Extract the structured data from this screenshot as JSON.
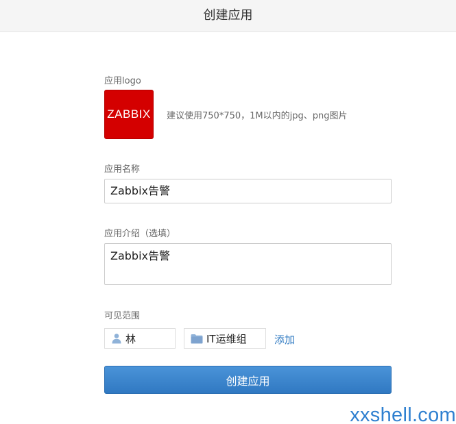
{
  "header": {
    "title": "创建应用"
  },
  "form": {
    "logo_label": "应用logo",
    "logo_text": "ZABBIX",
    "logo_hint": "建议使用750*750，1M以内的jpg、png图片",
    "name_label": "应用名称",
    "name_value": "Zabbix告警",
    "desc_label": "应用介绍（选填）",
    "desc_value": "Zabbix告警",
    "visibility_label": "可见范围",
    "visibility_items": [
      {
        "type": "user",
        "icon": "user-icon",
        "label": "林"
      },
      {
        "type": "department",
        "icon": "folder-icon",
        "label": "IT运维组"
      }
    ],
    "add_label": "添加",
    "submit_label": "创建应用"
  },
  "watermark": "xxshell.com",
  "colors": {
    "accent": "#3a86cc",
    "link": "#2f7ac2",
    "logo_bg": "#d40000",
    "icon": "#8fb2d8"
  }
}
